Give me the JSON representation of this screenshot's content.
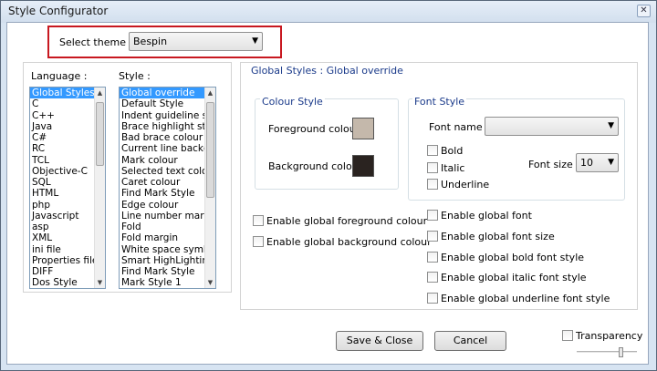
{
  "window": {
    "title": "Style Configurator",
    "close_glyph": "✕"
  },
  "theme": {
    "label": "Select theme :",
    "value": "Bespin"
  },
  "language": {
    "label": "Language :",
    "items": [
      "Global Styles",
      "C",
      "C++",
      "Java",
      "C#",
      "RC",
      "TCL",
      "Objective-C",
      "SQL",
      "HTML",
      "php",
      "Javascript",
      "asp",
      "XML",
      "ini file",
      "Properties file",
      "DIFF",
      "Dos Style"
    ],
    "selected_index": 0
  },
  "style": {
    "label": "Style :",
    "items": [
      "Global override",
      "Default Style",
      "Indent guideline sty",
      "Brace highlight style",
      "Bad brace colour",
      "Current line backgr",
      "Mark colour",
      "Selected text colour",
      "Caret colour",
      "Find Mark Style",
      "Edge colour",
      "Line number margin",
      "Fold",
      "Fold margin",
      "White space symbo",
      "Smart HighLighting",
      "Find Mark Style",
      "Mark Style 1"
    ],
    "selected_index": 0
  },
  "header_text": "Global Styles : Global override",
  "colour_style": {
    "title": "Colour Style",
    "foreground_label": "Foreground colour",
    "background_label": "Background colour",
    "foreground_color": "#c4b8ab",
    "background_color": "#2a2320"
  },
  "font_style": {
    "title": "Font Style",
    "font_name_label": "Font name :",
    "font_name_value": "",
    "bold_label": "Bold",
    "italic_label": "Italic",
    "underline_label": "Underline",
    "font_size_label": "Font size :",
    "font_size_value": "10"
  },
  "global_checks_left": [
    "Enable global foreground colour",
    "Enable global background colour"
  ],
  "global_checks_right": [
    "Enable global font",
    "Enable global font size",
    "Enable global bold font style",
    "Enable global italic font style",
    "Enable global underline font style"
  ],
  "buttons": {
    "save_close": "Save & Close",
    "cancel": "Cancel"
  },
  "transparency": {
    "label": "Transparency",
    "level_fraction": 0.75
  },
  "colors": {
    "accent_blue": "#3399ff",
    "highlight_red": "#c81820",
    "header_blue": "#1a3a8a",
    "group_title": "#1a3a8a"
  }
}
